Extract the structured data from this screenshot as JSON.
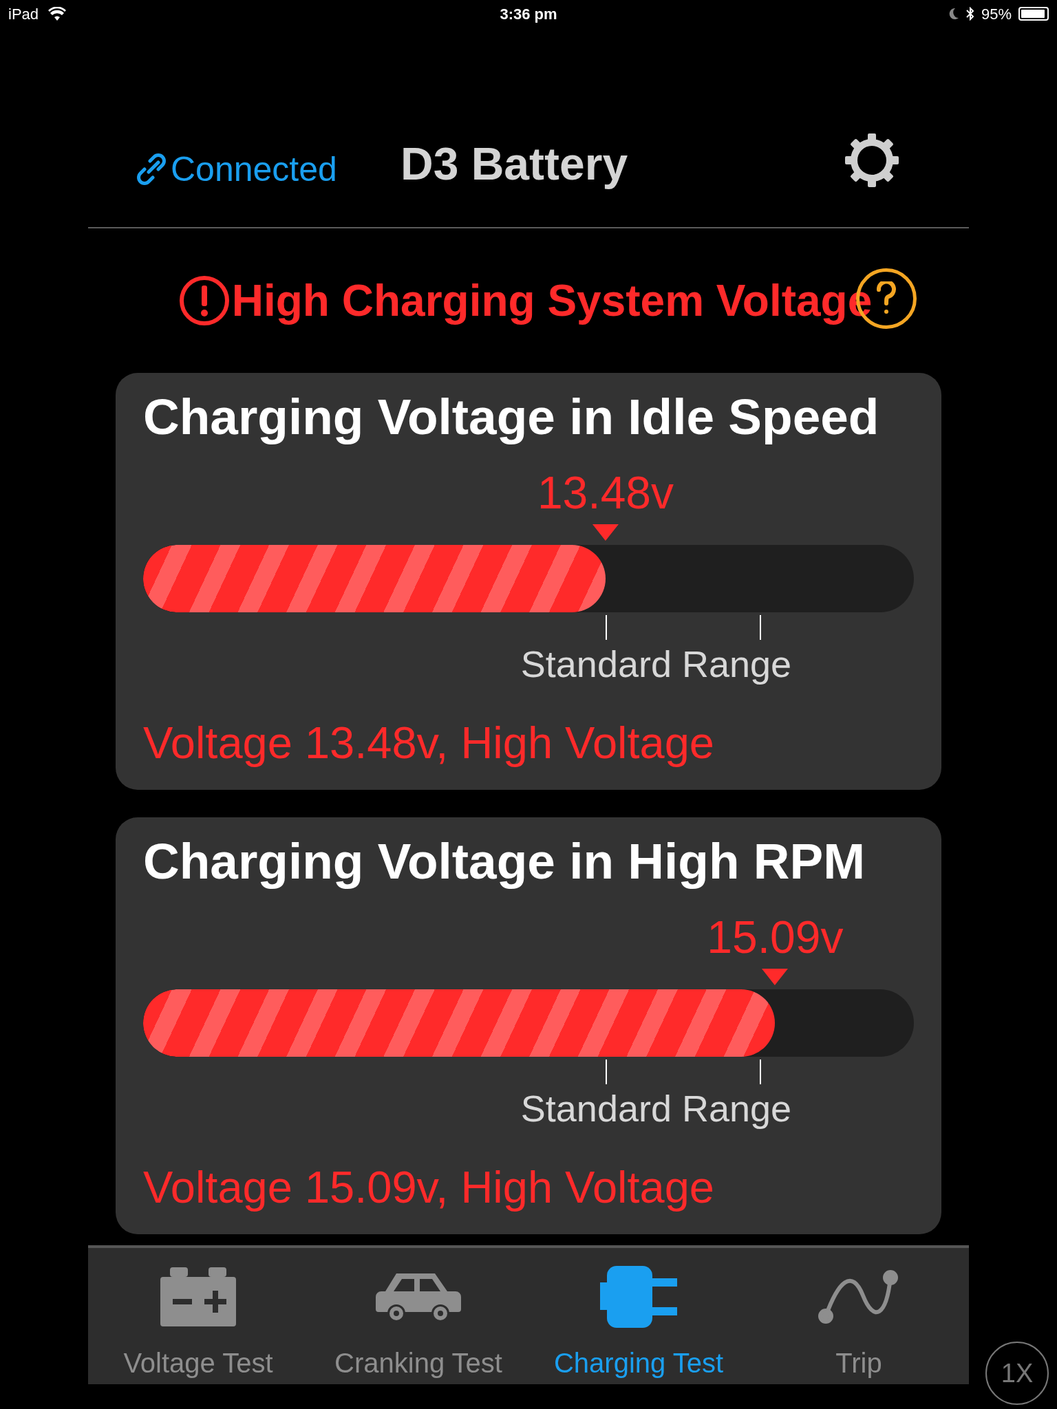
{
  "status_bar": {
    "device": "iPad",
    "time": "3:36 pm",
    "battery": "95%"
  },
  "header": {
    "connection": "Connected",
    "title": "D3 Battery"
  },
  "alert": {
    "text": "High Charging System Voltage"
  },
  "cards": [
    {
      "title": "Charging Voltage in Idle Speed",
      "reading": "13.48v",
      "level": 0.6,
      "range_label": "Standard Range",
      "status": "Voltage 13.48v, High Voltage"
    },
    {
      "title": "Charging Voltage in High RPM",
      "reading": "15.09v",
      "level": 0.82,
      "range_label": "Standard Range",
      "status": "Voltage 15.09v, High Voltage"
    }
  ],
  "tabs": [
    {
      "kind": "battery",
      "label": "Voltage Test",
      "selected": false
    },
    {
      "kind": "car",
      "label": "Cranking Test",
      "selected": false
    },
    {
      "kind": "plug",
      "label": "Charging Test",
      "selected": true
    },
    {
      "kind": "trip",
      "label": "Trip",
      "selected": false
    }
  ],
  "zoom_button": "1X"
}
